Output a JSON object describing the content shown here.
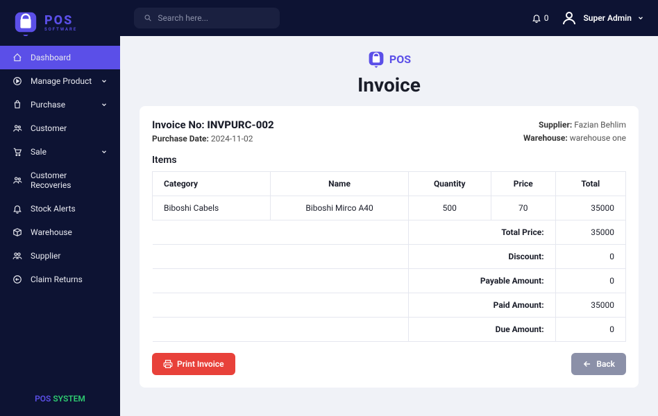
{
  "brand": {
    "name": "POS",
    "sub": "SOFTWARE"
  },
  "search": {
    "placeholder": "Search here..."
  },
  "notifications": {
    "count": "0"
  },
  "user": {
    "name": "Super Admin"
  },
  "sidebar": {
    "items": [
      {
        "label": "Dashboard",
        "active": true
      },
      {
        "label": "Manage Product",
        "expandable": true
      },
      {
        "label": "Purchase",
        "expandable": true
      },
      {
        "label": "Customer"
      },
      {
        "label": "Sale",
        "expandable": true
      },
      {
        "label": "Customer Recoveries"
      },
      {
        "label": "Stock Alerts"
      },
      {
        "label": "Warehouse"
      },
      {
        "label": "Supplier"
      },
      {
        "label": "Claim Returns"
      }
    ]
  },
  "footer": {
    "pos": "POS",
    "system": "SYSTEM"
  },
  "header": {
    "brand": "POS",
    "title": "Invoice"
  },
  "invoice": {
    "no_label": "Invoice No:",
    "no": "INVPURC-002",
    "date_label": "Purchase Date:",
    "date": "2024-11-02",
    "supplier_label": "Supplier:",
    "supplier": "Fazian Behlim",
    "warehouse_label": "Warehouse:",
    "warehouse": "warehouse one"
  },
  "items_title": "Items",
  "columns": {
    "category": "Category",
    "name": "Name",
    "qty": "Quantity",
    "price": "Price",
    "total": "Total"
  },
  "rows": [
    {
      "category": "Biboshi Cabels",
      "name": "Biboshi Mirco A40",
      "qty": "500",
      "price": "70",
      "total": "35000"
    }
  ],
  "summary": {
    "total_price_label": "Total Price:",
    "total_price": "35000",
    "discount_label": "Discount:",
    "discount": "0",
    "payable_label": "Payable Amount:",
    "payable": "0",
    "paid_label": "Paid Amount:",
    "paid": "35000",
    "due_label": "Due Amount:",
    "due": "0"
  },
  "buttons": {
    "print": "Print Invoice",
    "back": "Back"
  }
}
